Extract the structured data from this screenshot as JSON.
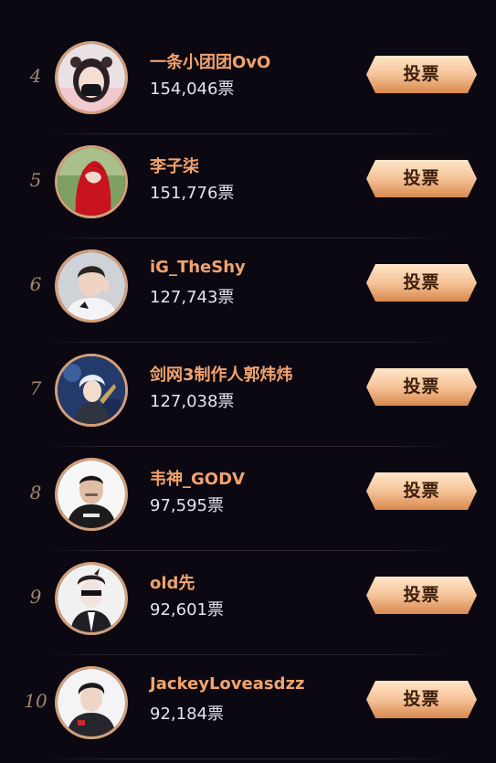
{
  "vote_button_label": "投票",
  "colors": {
    "background": "#0b0812",
    "name": "#f2a36d",
    "votes": "#e4e4ee",
    "rank": "#a08770",
    "avatar_border": "#d3a07c",
    "button_light": "#ffe4c6",
    "button_dark": "#d9894e",
    "button_text": "#3a1d0c"
  },
  "entries": [
    {
      "rank": "4",
      "name": "一条小团团OvO",
      "votes": "154,046票",
      "avatar_icon": "girl-masked-avatar-icon"
    },
    {
      "rank": "5",
      "name": "李子柒",
      "votes": "151,776票",
      "avatar_icon": "red-hood-avatar-icon"
    },
    {
      "rank": "6",
      "name": "iG_TheShy",
      "votes": "127,743票",
      "avatar_icon": "young-man-avatar-icon"
    },
    {
      "rank": "7",
      "name": "剑网3制作人郭炜炜",
      "votes": "127,038票",
      "avatar_icon": "anime-character-avatar-icon"
    },
    {
      "rank": "8",
      "name": "韦神_GODV",
      "votes": "97,595票",
      "avatar_icon": "man-jersey-avatar-icon"
    },
    {
      "rank": "9",
      "name": "old先",
      "votes": "92,601票",
      "avatar_icon": "suited-figure-avatar-icon"
    },
    {
      "rank": "10",
      "name": "JackeyLoveasdzz",
      "votes": "92,184票",
      "avatar_icon": "player-jersey-avatar-icon"
    }
  ]
}
